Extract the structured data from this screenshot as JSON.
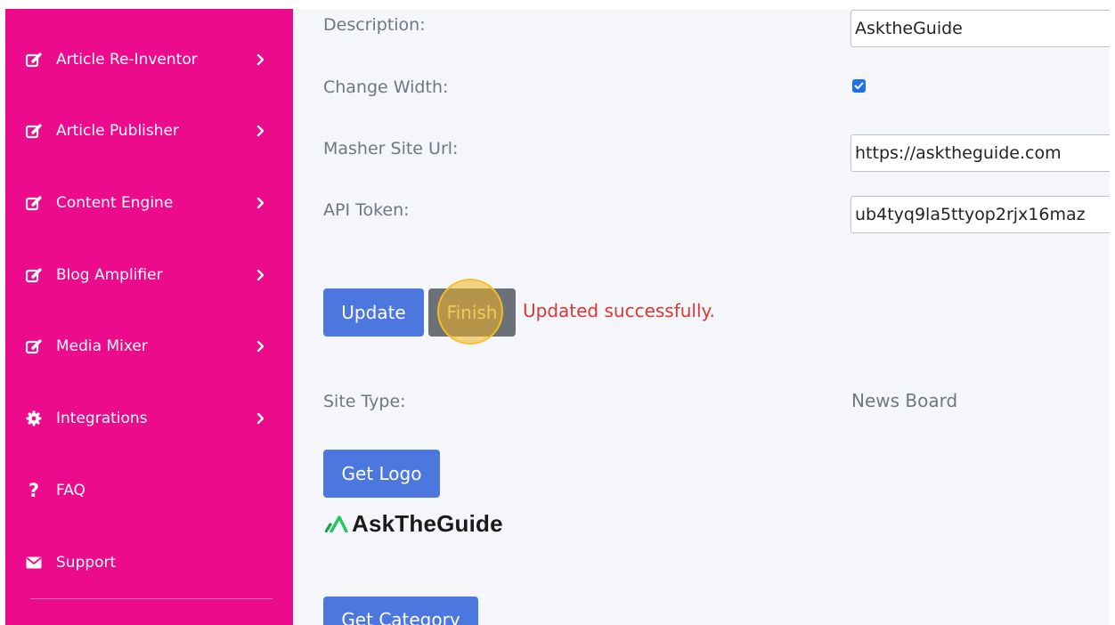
{
  "sidebar": {
    "items": [
      {
        "label": "Article Re-Inventor",
        "icon": "edit-icon"
      },
      {
        "label": "Article Publisher",
        "icon": "edit-icon"
      },
      {
        "label": "Content Engine",
        "icon": "edit-icon"
      },
      {
        "label": "Blog Amplifier",
        "icon": "edit-icon"
      },
      {
        "label": "Media Mixer",
        "icon": "edit-icon"
      },
      {
        "label": "Integrations",
        "icon": "gear-icon"
      },
      {
        "label": "FAQ",
        "icon": "question-icon"
      },
      {
        "label": "Support",
        "icon": "envelope-icon"
      }
    ]
  },
  "form": {
    "description_label": "Description:",
    "description_value": "AsktheGuide",
    "change_width_label": "Change Width:",
    "change_width_checked": true,
    "masher_url_label": "Masher Site Url:",
    "masher_url_value": "https://asktheguide.com",
    "api_token_label": "API Token:",
    "api_token_value": "ub4tyq9la5ttyop2rjx16maz"
  },
  "actions": {
    "update_label": "Update",
    "finish_label": "Finish",
    "status_message": "Updated successfully."
  },
  "site": {
    "type_label": "Site Type:",
    "type_value": "News Board",
    "get_logo_label": "Get Logo",
    "logo_text": "AskTheGuide",
    "get_category_label": "Get Category"
  },
  "colors": {
    "sidebar_bg": "#ec0b8d",
    "primary_button": "#4c77df",
    "secondary_button": "#6b7079",
    "success_message": "#dc3636",
    "logo_accent": "#22c55e"
  }
}
